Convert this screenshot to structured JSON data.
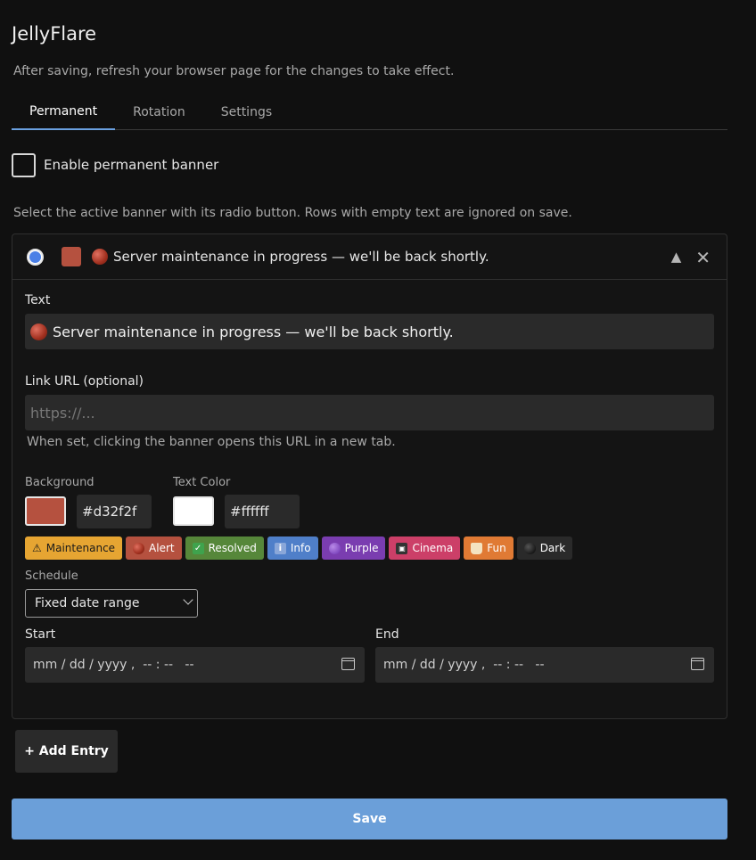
{
  "app": {
    "title": "JellyFlare",
    "subtitle": "After saving, refresh your browser page for the changes to take effect."
  },
  "tabs": [
    {
      "label": "Permanent",
      "active": true
    },
    {
      "label": "Rotation",
      "active": false
    },
    {
      "label": "Settings",
      "active": false
    }
  ],
  "permanent": {
    "enable_label": "Enable permanent banner",
    "enabled": false,
    "help": "Select the active banner with its radio button. Rows with empty text are ignored on save."
  },
  "entry": {
    "selected": true,
    "header_text": "Server maintenance in progress — we'll be back shortly.",
    "text_label": "Text",
    "text_value": "Server maintenance in progress — we'll be back shortly.",
    "link_label": "Link URL (optional)",
    "link_value": "",
    "link_placeholder": "https://...",
    "link_hint": "When set, clicking the banner opens this URL in a new tab.",
    "background_label": "Background",
    "background_hex": "#d32f2f",
    "background_swatch": "#b5513f",
    "text_color_label": "Text Color",
    "text_color_hex": "#ffffff",
    "text_color_swatch": "#ffffff",
    "presets": [
      {
        "label": "Maintenance",
        "bg": "#e6a532",
        "fg": "#1a1a1a",
        "icon": "warning-icon"
      },
      {
        "label": "Alert",
        "bg": "#b5513f",
        "fg": "#ffffff",
        "icon": "red-circle-icon"
      },
      {
        "label": "Resolved",
        "bg": "#56873a",
        "fg": "#ffffff",
        "icon": "check-mark-icon"
      },
      {
        "label": "Info",
        "bg": "#4f7fc9",
        "fg": "#ffffff",
        "icon": "info-icon"
      },
      {
        "label": "Purple",
        "bg": "#7a3db0",
        "fg": "#ffffff",
        "icon": "purple-circle-icon"
      },
      {
        "label": "Cinema",
        "bg": "#cc3f68",
        "fg": "#ffffff",
        "icon": "clapper-board-icon"
      },
      {
        "label": "Fun",
        "bg": "#e07a34",
        "fg": "#ffffff",
        "icon": "popcorn-icon"
      },
      {
        "label": "Dark",
        "bg": "#2a2a2a",
        "fg": "#ffffff",
        "icon": "black-circle-icon"
      }
    ],
    "schedule_label": "Schedule",
    "schedule_value": "Fixed date range",
    "start_label": "Start",
    "start_value": "mm / dd / yyyy ,  -- : --   --",
    "end_label": "End",
    "end_value": "mm / dd / yyyy ,  -- : --   --"
  },
  "actions": {
    "add_label": "+ Add Entry",
    "save_label": "Save"
  },
  "colors": {
    "accent": "#6aa0e0",
    "save_button": "#6b9fd9",
    "radio_selected": "#4a7fe6"
  }
}
